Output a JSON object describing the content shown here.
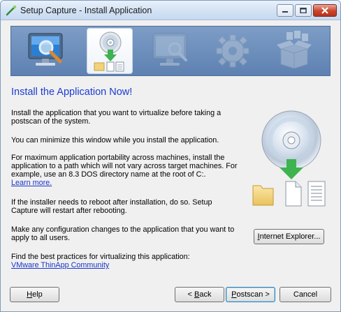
{
  "window": {
    "title": "Setup Capture - Install Application"
  },
  "banner": {
    "steps": [
      {
        "name": "prescan",
        "icon": "monitor-magnifier-icon",
        "state": "inactive"
      },
      {
        "name": "install",
        "icon": "disc-install-icon",
        "state": "active"
      },
      {
        "name": "postscan",
        "icon": "monitor-scan-icon",
        "state": "disabled"
      },
      {
        "name": "configure",
        "icon": "gear-icon",
        "state": "disabled"
      },
      {
        "name": "build",
        "icon": "package-icon",
        "state": "disabled"
      }
    ]
  },
  "main": {
    "heading": "Install the Application Now!",
    "para1": "Install the application that you want to virtualize before taking a postscan of the system.",
    "para2": "You can minimize this window while you install the application.",
    "para3": "For maximum application portability across machines, install the application to a path which will not vary across target machines. For example, use an 8.3 DOS directory name at the root of C:.",
    "learn_more": "Learn more.",
    "para4": "If the installer needs to reboot after installation, do so. Setup Capture will restart after rebooting.",
    "para5": "Make any configuration changes to the application that you want to apply to all users.",
    "para6": "Find the best practices for virtualizing this application:",
    "community_link": "VMware ThinApp Community",
    "ie_button": {
      "before": "",
      "mnemonic": "I",
      "after": "nternet Explorer..."
    }
  },
  "footer": {
    "help": {
      "before": "",
      "mnemonic": "H",
      "after": "elp"
    },
    "back": {
      "before": "< ",
      "mnemonic": "B",
      "after": "ack"
    },
    "postscan": {
      "before": "",
      "mnemonic": "P",
      "after": "ostscan >"
    },
    "cancel": "Cancel"
  },
  "colors": {
    "banner": "#6a8cbc",
    "heading": "#1b3bd1",
    "link": "#1a35c9",
    "accent_green": "#3fb34f"
  }
}
